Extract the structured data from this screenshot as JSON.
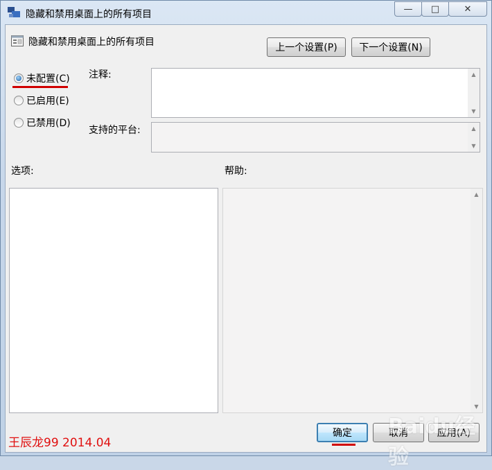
{
  "window": {
    "title": "隐藏和禁用桌面上的所有项目",
    "caption_buttons": {
      "minimize": "—",
      "maximize": "□",
      "close": "✕"
    }
  },
  "policy": {
    "title": "隐藏和禁用桌面上的所有项目",
    "prev_button": "上一个设置(P)",
    "next_button": "下一个设置(N)"
  },
  "state": {
    "options": [
      {
        "label": "未配置(C)",
        "checked": true
      },
      {
        "label": "已启用(E)",
        "checked": false
      },
      {
        "label": "已禁用(D)",
        "checked": false
      }
    ]
  },
  "fields": {
    "comment_label": "注释:",
    "comment_value": "",
    "platform_label": "支持的平台:",
    "platform_value": ""
  },
  "panes": {
    "options_label": "选项:",
    "help_label": "帮助:"
  },
  "footer": {
    "ok": "确定",
    "cancel": "取消",
    "apply": "应用(A)"
  },
  "overlay": {
    "watermark": "王辰龙99 2014.04",
    "baidu": "Baidu经验"
  },
  "colors": {
    "accent_underline": "#d00000",
    "watermark_text": "#e01010"
  }
}
